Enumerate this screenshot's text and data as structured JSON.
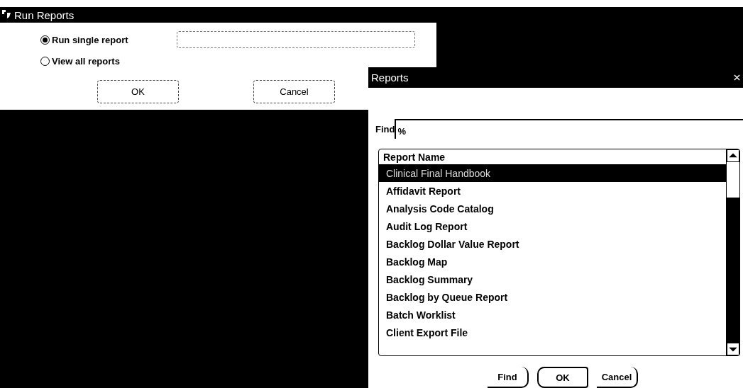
{
  "run_reports": {
    "title": "Run Reports",
    "options": [
      {
        "label": "Run single report",
        "selected": true
      },
      {
        "label": "View all reports",
        "selected": false
      }
    ],
    "buttons": [
      "OK",
      "Cancel"
    ]
  },
  "reports_dialog": {
    "title": "Reports",
    "find_label": "Find",
    "find_value": "%",
    "list": {
      "column": "Report Name",
      "rows": [
        {
          "name": "Clinical Final Handbook",
          "selected": true
        },
        {
          "name": "Affidavit Report",
          "selected": false
        },
        {
          "name": "Analysis Code Catalog",
          "selected": false
        },
        {
          "name": "Audit Log Report",
          "selected": false
        },
        {
          "name": "Backlog Dollar Value Report",
          "selected": false
        },
        {
          "name": "Backlog Map",
          "selected": false
        },
        {
          "name": "Backlog Summary",
          "selected": false
        },
        {
          "name": "Backlog by Queue Report",
          "selected": false
        },
        {
          "name": "Batch Worklist",
          "selected": false
        },
        {
          "name": "Client Export File",
          "selected": false
        }
      ]
    },
    "buttons": [
      {
        "label": "Find",
        "default": false
      },
      {
        "label": "OK",
        "default": true
      },
      {
        "label": "Cancel",
        "default": false
      }
    ]
  }
}
